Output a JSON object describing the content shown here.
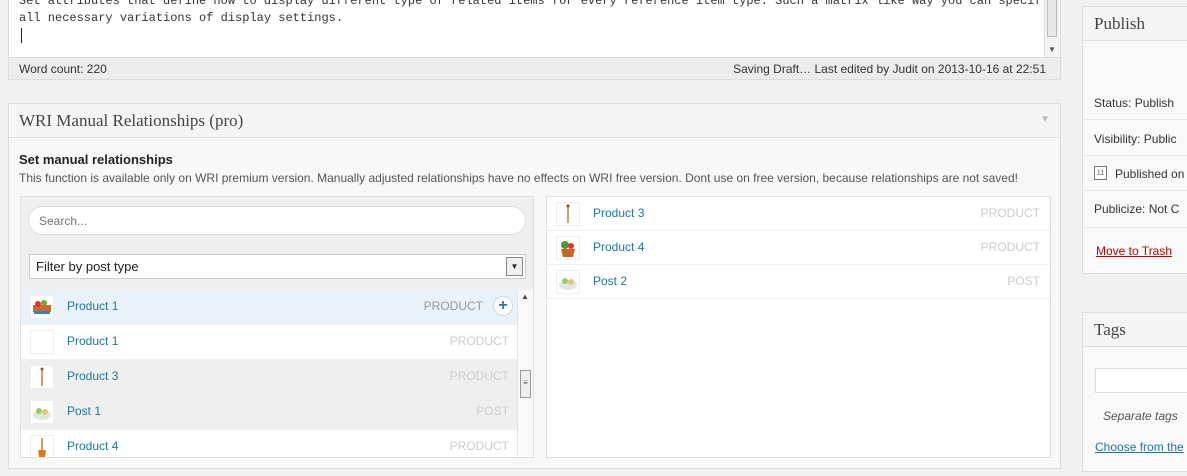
{
  "editor": {
    "lines": [
      "Set attributes that define how to display different type of related items for every reference item type. Such a matrix like way you can specify",
      "all necessary variations of display settings."
    ],
    "word_count": "Word count: 220",
    "draft_status": "Saving Draft… Last edited by Judit on 2013-10-16 at 22:51"
  },
  "relationships": {
    "title": "WRI Manual Relationships (pro)",
    "heading": "Set manual relationships",
    "description": "This function is available only on WRI premium version. Manually adjusted relationships have no effects on WRI free version. Dont use on free version, because relationships are not saved!",
    "search_placeholder": "Search...",
    "filter_label": "Filter by post type",
    "choices": [
      {
        "name": "Product 1",
        "type": "PRODUCT",
        "icon": "basket-image"
      },
      {
        "name": "Product 1",
        "type": "PRODUCT",
        "icon": "blank-image"
      },
      {
        "name": "Product 3",
        "type": "PRODUCT",
        "icon": "stick-image"
      },
      {
        "name": "Post 1",
        "type": "POST",
        "icon": "food-image"
      },
      {
        "name": "Product 4",
        "type": "PRODUCT",
        "icon": "plant-image"
      }
    ],
    "selected": [
      {
        "name": "Product 3",
        "type": "PRODUCT",
        "icon": "stick-image"
      },
      {
        "name": "Product 4",
        "type": "PRODUCT",
        "icon": "plant-image"
      },
      {
        "name": "Post 2",
        "type": "POST",
        "icon": "food-image"
      }
    ]
  },
  "publish": {
    "title": "Publish",
    "status": "Status: Publish",
    "visibility": "Visibility: Public",
    "published_on": "Published on",
    "publicize": "Publicize: Not C",
    "trash": "Move to Trash"
  },
  "tags": {
    "title": "Tags",
    "hint": "Separate tags",
    "choose": "Choose from the"
  }
}
